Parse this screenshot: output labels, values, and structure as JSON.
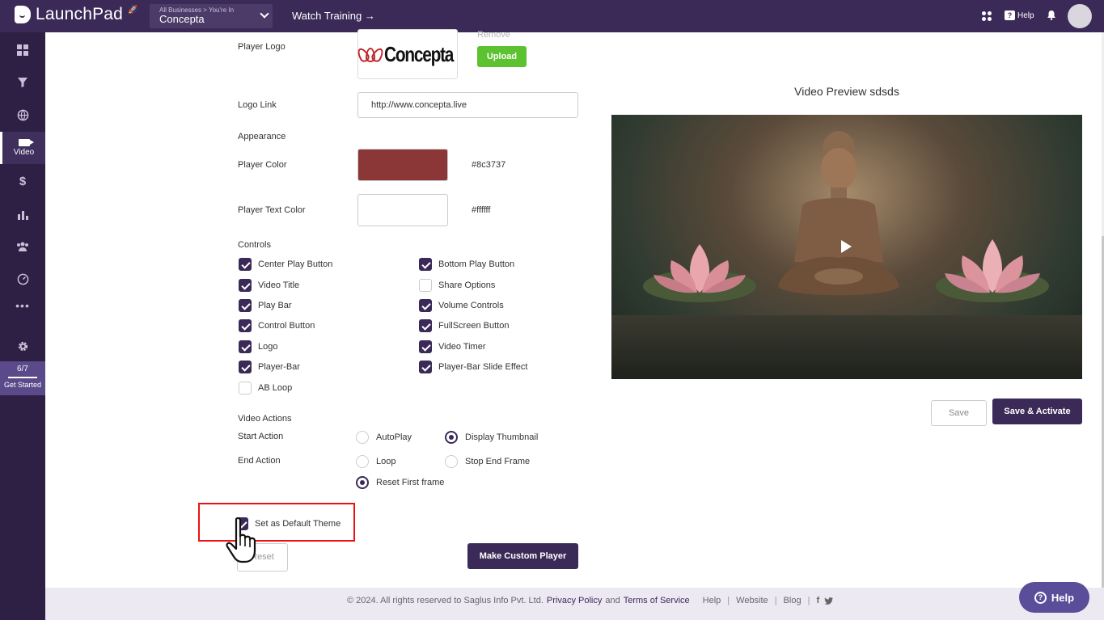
{
  "header": {
    "brand": "LaunchPad",
    "business_label": "All Businesses > You're In",
    "business_name": "Concepta",
    "watch_training": "Watch Training →",
    "help": "Help"
  },
  "sidebar": {
    "active_label": "Video",
    "progress": "6/7",
    "get_started": "Get Started"
  },
  "player": {
    "logo_label": "Player Logo",
    "logo_word": "Concepta",
    "remove": "Remove",
    "upload": "Upload",
    "logo_link_label": "Logo Link",
    "logo_link_value": "http://www.concepta.live",
    "appearance": "Appearance",
    "player_color_label": "Player Color",
    "player_color": "#8c3737",
    "player_text_color_label": "Player Text Color",
    "player_text_color": "#ffffff"
  },
  "controls": {
    "title": "Controls",
    "left": [
      {
        "label": "Center Play Button",
        "checked": true
      },
      {
        "label": "Video Title",
        "checked": true
      },
      {
        "label": "Play Bar",
        "checked": true
      },
      {
        "label": "Control Button",
        "checked": true
      },
      {
        "label": "Logo",
        "checked": true
      },
      {
        "label": "Player-Bar",
        "checked": true
      },
      {
        "label": "AB Loop",
        "checked": false
      }
    ],
    "right": [
      {
        "label": "Bottom Play Button",
        "checked": true
      },
      {
        "label": "Share Options",
        "checked": false
      },
      {
        "label": "Volume Controls",
        "checked": true
      },
      {
        "label": "FullScreen Button",
        "checked": true
      },
      {
        "label": "Video Timer",
        "checked": true
      },
      {
        "label": "Player-Bar Slide Effect",
        "checked": true
      }
    ]
  },
  "actions": {
    "title": "Video Actions",
    "start_label": "Start Action",
    "start_options": [
      {
        "label": "AutoPlay",
        "selected": false
      },
      {
        "label": "Display Thumbnail",
        "selected": true
      }
    ],
    "end_label": "End Action",
    "end_options": [
      {
        "label": "Loop",
        "selected": false
      },
      {
        "label": "Stop End Frame",
        "selected": false
      },
      {
        "label": "Reset First frame",
        "selected": true
      }
    ]
  },
  "default_theme": {
    "label": "Set as Default Theme",
    "checked": true
  },
  "buttons": {
    "reset": "Reset",
    "make_custom": "Make Custom Player",
    "save": "Save",
    "save_activate": "Save & Activate"
  },
  "preview": {
    "title": "Video Preview sdsds"
  },
  "footer": {
    "copyright": "©  2024. All rights reserved to Saglus Info Pvt. Ltd.",
    "privacy": "Privacy Policy",
    "and": "and",
    "terms": "Terms of Service",
    "links": [
      "Help",
      "Website",
      "Blog"
    ]
  },
  "help_button": "Help",
  "colors": {
    "accent": "#3b2a57",
    "upload_green": "#5cc230",
    "highlight_red": "#e11111"
  }
}
